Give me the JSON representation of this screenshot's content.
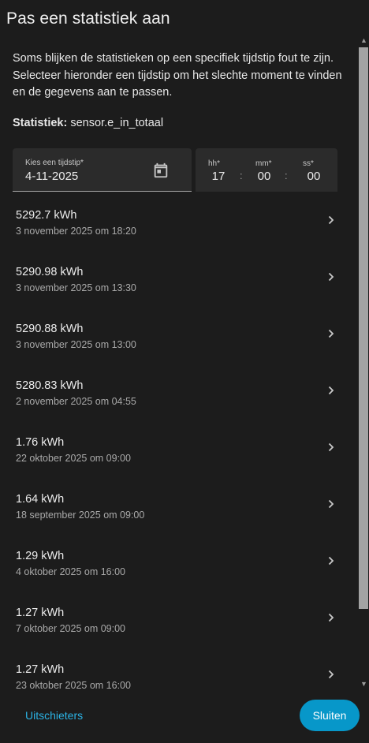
{
  "dialog": {
    "title": "Pas een statistiek aan",
    "description": "Soms blijken de statistieken op een specifiek tijdstip fout te zijn. Selecteer hieronder een tijdstip om het slechte moment te vinden en de gegevens aan te passen.",
    "statistic_label": "Statistiek:",
    "statistic_value": "sensor.e_in_totaal"
  },
  "date_picker": {
    "label": "Kies een tijdstip*",
    "value": "4-11-2025",
    "icon": "calendar-icon"
  },
  "time_picker": {
    "hh_label": "hh*",
    "mm_label": "mm*",
    "ss_label": "ss*",
    "hh": "17",
    "mm": "00",
    "ss": "00",
    "separator": ":"
  },
  "entries": [
    {
      "value": "5292.7 kWh",
      "date": "3 november 2025 om 18:20"
    },
    {
      "value": "5290.98 kWh",
      "date": "3 november 2025 om 13:30"
    },
    {
      "value": "5290.88 kWh",
      "date": "3 november 2025 om 13:00"
    },
    {
      "value": "5280.83 kWh",
      "date": "2 november 2025 om 04:55"
    },
    {
      "value": "1.76 kWh",
      "date": "22 oktober 2025 om 09:00"
    },
    {
      "value": "1.64 kWh",
      "date": "18 september 2025 om 09:00"
    },
    {
      "value": "1.29 kWh",
      "date": "4 oktober 2025 om 16:00"
    },
    {
      "value": "1.27 kWh",
      "date": "7 oktober 2025 om 09:00"
    },
    {
      "value": "1.27 kWh",
      "date": "23 oktober 2025 om 16:00"
    }
  ],
  "footer": {
    "outliers_label": "Uitschieters",
    "close_label": "Sluiten"
  },
  "colors": {
    "background": "#1c1c1c",
    "accent": "#0797c9",
    "link": "#2bb3e5"
  }
}
